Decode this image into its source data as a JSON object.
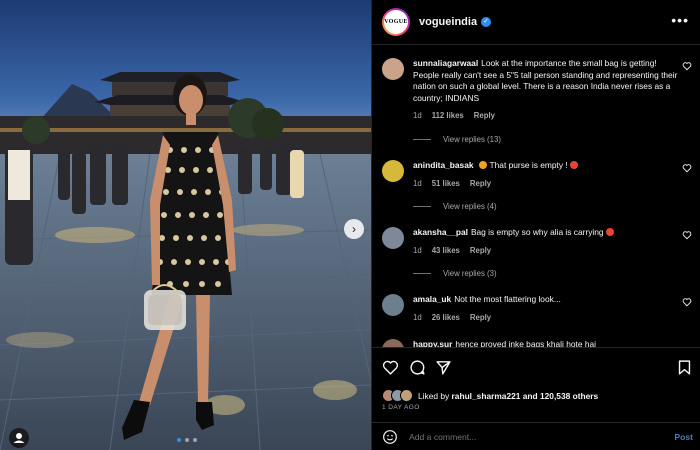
{
  "post": {
    "account": "vogueindia",
    "avatar_text": "VOGUE",
    "more_glyph": "•••",
    "next_glyph": "›",
    "carousel": {
      "count": 3,
      "active": 1
    }
  },
  "comments": [
    {
      "user": "sunnaliagarwaal",
      "text": "Look at the importance the small bag is getting! People really can't see a 5\"5 tall person standing and representing their nation on such a global level. There is a reason India never rises as a country; INDIANS",
      "time": "1d",
      "likes": "112 likes",
      "reply": "Reply",
      "view_replies": "View replies (13)",
      "avatar_color": "#c9a48a"
    },
    {
      "user": "anindita_basak",
      "text": "That purse is empty !",
      "emoji_before": true,
      "emoji_after": true,
      "time": "1d",
      "likes": "51 likes",
      "reply": "Reply",
      "view_replies": "View replies (4)",
      "avatar_color": "#d6b93a"
    },
    {
      "user": "akansha__pal",
      "text": "Bag is empty so why alia is carrying",
      "emoji_after": true,
      "time": "1d",
      "likes": "43 likes",
      "reply": "Reply",
      "view_replies": "View replies (3)",
      "avatar_color": "#7d8898"
    },
    {
      "user": "amala_uk",
      "text": "Not the most flattering look...",
      "time": "1d",
      "likes": "26 likes",
      "reply": "Reply",
      "avatar_color": "#6b7f8e"
    },
    {
      "user": "happy.sur",
      "text": "hence proved inke bags khali hote hai",
      "time": "",
      "avatar_color": "#8a6a5a"
    }
  ],
  "actions": {
    "liked_by_prefix": "Liked by",
    "liked_by_user": "rahul_sharma221",
    "liked_by_suffix": "and 120,538 others",
    "time_ago": "1 DAY AGO"
  },
  "add_comment": {
    "placeholder": "Add a comment...",
    "post_label": "Post"
  },
  "colors": {
    "accent": "#2f8ef5",
    "emoji": "#f0a31c",
    "emoji_red": "#e8443a"
  }
}
